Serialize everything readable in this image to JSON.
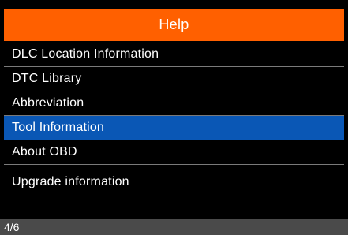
{
  "header": {
    "title": "Help"
  },
  "menu": {
    "items": [
      {
        "label": "DLC Location Information",
        "selected": false
      },
      {
        "label": "DTC Library",
        "selected": false
      },
      {
        "label": "Abbreviation",
        "selected": false
      },
      {
        "label": "Tool Information",
        "selected": true
      },
      {
        "label": "About OBD",
        "selected": false
      },
      {
        "label": "Upgrade information",
        "selected": false
      }
    ]
  },
  "status": {
    "page_indicator": "4/6"
  },
  "colors": {
    "header_bg": "#ff6000",
    "selected_bg": "#0a57b5",
    "background": "#000000",
    "status_bg": "#4a4a4a"
  }
}
